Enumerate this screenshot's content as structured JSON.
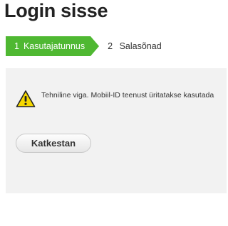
{
  "header": {
    "title": "Login sisse"
  },
  "steps": [
    {
      "number": "1",
      "label": "Kasutajatunnus",
      "state": "active"
    },
    {
      "number": "2",
      "label": "Salasõnad",
      "state": "inactive"
    }
  ],
  "alert": {
    "icon": "warning-triangle-icon",
    "text": "Tehniline viga. Mobiil-ID teenust üritatakse kasutada"
  },
  "actions": {
    "cancel_label": "Katkestan"
  },
  "colors": {
    "accent": "#4fb832",
    "warning": "#f5d800",
    "panel": "#f2f2f2"
  }
}
